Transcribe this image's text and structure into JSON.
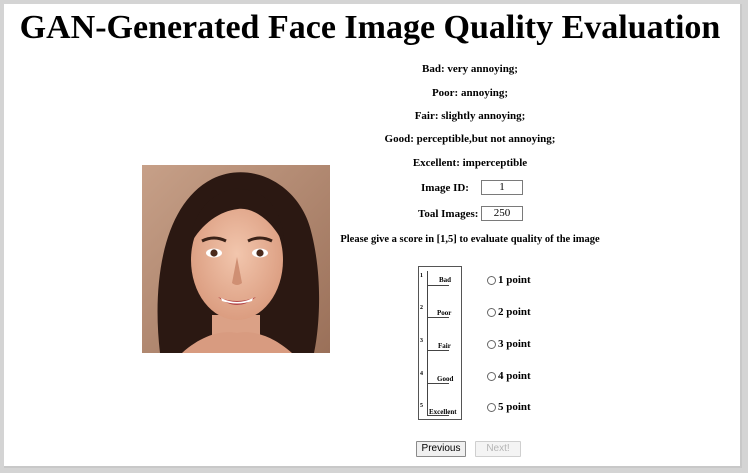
{
  "page": {
    "title": "GAN-Generated Face Image Quality Evaluation"
  },
  "legend": [
    "Bad: very annoying;",
    "Poor: annoying;",
    "Fair: slightly annoying;",
    "Good: perceptible,but not annoying;",
    "Excellent: imperceptible"
  ],
  "fields": {
    "image_id_label": "Image ID:",
    "image_id_value": "1",
    "total_label": "Toal Images:",
    "total_value": "250"
  },
  "prompt": "Please give a score in [1,5] to evaluate quality of the image",
  "scale": {
    "ticks": [
      "1",
      "2",
      "3",
      "4",
      "5"
    ],
    "labels": [
      "Bad",
      "Poor",
      "Fair",
      "Good",
      "Excellent"
    ]
  },
  "options": [
    "1 point",
    "2 point",
    "3 point",
    "4 point",
    "5 point"
  ],
  "selected_option": null,
  "buttons": {
    "previous": "Previous",
    "next": "Next!",
    "next_disabled": true
  },
  "colors": {
    "background": "#d4d4d4",
    "panel": "#ffffff"
  }
}
